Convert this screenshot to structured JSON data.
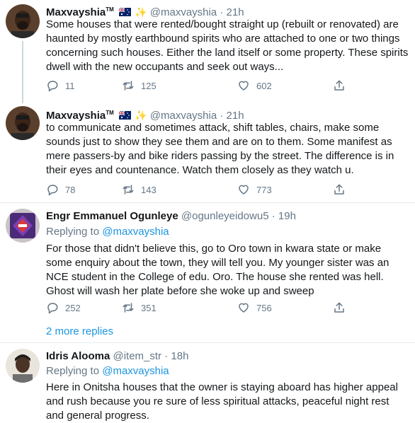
{
  "tweets": [
    {
      "name": "Maxvayshia",
      "tm": "TM",
      "handle": "@maxvayshia",
      "dot": "·",
      "time": "21h",
      "text": "Some houses that were rented/bought straight up (rebuilt or renovated) are haunted by mostly earthbound spirits who are attached to one or two things concerning such houses. Either the land itself or some property. These spirits dwell with the new occupants and seek out ways...",
      "replies": "11",
      "retweets": "125",
      "likes": "602"
    },
    {
      "name": "Maxvayshia",
      "tm": "TM",
      "handle": "@maxvayshia",
      "dot": "·",
      "time": "21h",
      "text": "to communicate and sometimes attack, shift tables, chairs, make some sounds just to show they see them and are on to them. Some manifest as mere passers-by and bike riders passing by the street. The difference is in their eyes and countenance. Watch them closely as they watch u.",
      "replies": "78",
      "retweets": "143",
      "likes": "773"
    },
    {
      "name": "Engr Emmanuel Ogunleye",
      "handle": "@ogunleyeidowu5",
      "dot": "·",
      "time": "19h",
      "replying_prefix": "Replying to ",
      "replying_to": "@maxvayshia",
      "text": "For those that didn't believe this, go to Oro town in kwara state or make some enquiry about the town, they will tell you. My younger sister was an NCE student in the College of edu. Oro. The house she rented was hell. Ghost will wash her plate before she woke up and sweep",
      "replies": "252",
      "retweets": "351",
      "likes": "756"
    },
    {
      "name": "Idris Alooma",
      "handle": "@item_str",
      "dot": "·",
      "time": "18h",
      "replying_prefix": "Replying to ",
      "replying_to": "@maxvayshia",
      "text": "Here in Onitsha houses that the owner is staying aboard has higher appeal and rush because you re sure of less spiritual attacks, peaceful night rest and general progress."
    }
  ],
  "more_replies": "2 more replies",
  "icons": {
    "reply": "reply-icon",
    "retweet": "retweet-icon",
    "like": "heart-icon",
    "share": "share-icon",
    "flag": "australia-flag-icon",
    "sparkle": "sparkles-icon"
  },
  "colors": {
    "link": "#1b95e0",
    "secondary_text": "#657786",
    "divider": "#e6ecf0",
    "thread_line": "#ccd6dd"
  }
}
